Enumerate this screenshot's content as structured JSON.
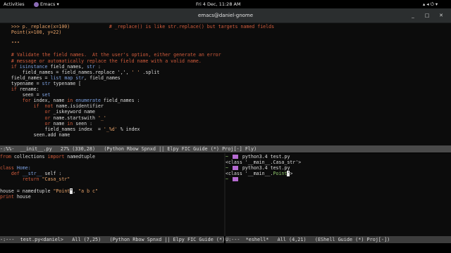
{
  "topbar": {
    "activities": "Activities",
    "app_name": "Emacs",
    "datetime": "Fri  4 Dec, 11:28 AM"
  },
  "window": {
    "title": "emacs@daniel-gnome"
  },
  "top_pane": {
    "lines": [
      [
        {
          "t": "    >>> p._replace(x=100)",
          "c": "c-str"
        },
        {
          "t": "              # _replace() is like str.replace() but targets named fields",
          "c": "c-com"
        }
      ],
      [
        {
          "t": "    Point(x=100, y=22)",
          "c": "c-str"
        }
      ],
      [
        {
          "t": "",
          "c": "c-txt"
        }
      ],
      [
        {
          "t": "    \"\"\"",
          "c": "c-str"
        }
      ],
      [
        {
          "t": "",
          "c": "c-txt"
        }
      ],
      [
        {
          "t": "    # Validate the field names.  At the user's option, either generate an error",
          "c": "c-com"
        }
      ],
      [
        {
          "t": "    # message or automatically replace the field name with a valid name.",
          "c": "c-com"
        }
      ],
      [
        {
          "t": "    if ",
          "c": "c-kw"
        },
        {
          "t": "isinstance",
          "c": "c-fn"
        },
        {
          "t": " field_names, ",
          "c": "c-txt"
        },
        {
          "t": "str",
          "c": "c-fn"
        },
        {
          "t": " :",
          "c": "c-txt"
        }
      ],
      [
        {
          "t": "        field_names = field_names.replace ','",
          "c": "c-txt"
        },
        {
          "t": ",",
          "c": "c-txt"
        },
        {
          "t": " ' '",
          "c": "c-str"
        },
        {
          "t": " .split",
          "c": "c-txt"
        }
      ],
      [
        {
          "t": "    field_names = ",
          "c": "c-txt"
        },
        {
          "t": "list",
          "c": "c-fn"
        },
        {
          "t": " ",
          "c": "c-txt"
        },
        {
          "t": "map",
          "c": "c-fn"
        },
        {
          "t": " ",
          "c": "c-txt"
        },
        {
          "t": "str",
          "c": "c-fn"
        },
        {
          "t": ", field_names",
          "c": "c-txt"
        }
      ],
      [
        {
          "t": "    typename = ",
          "c": "c-txt"
        },
        {
          "t": "str",
          "c": "c-fn"
        },
        {
          "t": " typename ",
          "c": "c-txt"
        },
        {
          "t": "[",
          "c": "c-txt"
        }
      ],
      [
        {
          "t": "    if ",
          "c": "c-kw"
        },
        {
          "t": "rename:",
          "c": "c-txt"
        }
      ],
      [
        {
          "t": "        seen = ",
          "c": "c-txt"
        },
        {
          "t": "set",
          "c": "c-fn"
        }
      ],
      [
        {
          "t": "        for ",
          "c": "c-kw"
        },
        {
          "t": "index, name ",
          "c": "c-txt"
        },
        {
          "t": "in ",
          "c": "c-kw"
        },
        {
          "t": "enumerate",
          "c": "c-fn"
        },
        {
          "t": " field_names :",
          "c": "c-txt"
        }
      ],
      [
        {
          "t": "            if ",
          "c": "c-kw"
        },
        {
          "t": " not ",
          "c": "c-kw"
        },
        {
          "t": "name.isidentifier",
          "c": "c-txt"
        }
      ],
      [
        {
          "t": "                or ",
          "c": "c-kw"
        },
        {
          "t": "_iskeyword name",
          "c": "c-txt"
        }
      ],
      [
        {
          "t": "                or ",
          "c": "c-kw"
        },
        {
          "t": "name.startswith ",
          "c": "c-txt"
        },
        {
          "t": "'_'",
          "c": "c-str"
        }
      ],
      [
        {
          "t": "                or ",
          "c": "c-kw"
        },
        {
          "t": "name ",
          "c": "c-txt"
        },
        {
          "t": "in ",
          "c": "c-kw"
        },
        {
          "t": "seen :",
          "c": "c-txt"
        }
      ],
      [
        {
          "t": "                field_names index  = ",
          "c": "c-txt"
        },
        {
          "t": "'_%d'",
          "c": "c-str"
        },
        {
          "t": " % index",
          "c": "c-txt"
        }
      ],
      [
        {
          "t": "            seen.add name",
          "c": "c-txt"
        }
      ]
    ]
  },
  "modeline_top": "-:%%-  __init__.py   27% (330,28)   (Python Rbow Spnxd || Elpy FIC Guide (*) Proj[-] Fly)",
  "left_pane": {
    "lines": [
      [
        {
          "t": "from ",
          "c": "c-kw"
        },
        {
          "t": "collections ",
          "c": "c-txt"
        },
        {
          "t": "import ",
          "c": "c-kw"
        },
        {
          "t": "namedtuple",
          "c": "c-txt"
        }
      ],
      [
        {
          "t": "",
          "c": "c-txt"
        }
      ],
      [
        {
          "t": "class ",
          "c": "c-kw"
        },
        {
          "t": "Home:",
          "c": "c-cls"
        }
      ],
      [
        {
          "t": "    def ",
          "c": "c-kw"
        },
        {
          "t": "__str__",
          "c": "c-fn"
        },
        {
          "t": " self :",
          "c": "c-txt"
        }
      ],
      [
        {
          "t": "        return ",
          "c": "c-kw"
        },
        {
          "t": "\"Casa_str\"",
          "c": "c-str"
        }
      ],
      [
        {
          "t": "",
          "c": "c-txt"
        }
      ],
      [
        {
          "t": "house = namedtuple ",
          "c": "c-txt"
        },
        {
          "t": "\"Point",
          "c": "c-str"
        },
        {
          "t": "\"",
          "c": "cursor"
        },
        {
          "t": ", ",
          "c": "c-txt"
        },
        {
          "t": "\"a b c\"",
          "c": "c-str"
        }
      ],
      [
        {
          "t": "print ",
          "c": "c-kw"
        },
        {
          "t": "house",
          "c": "c-txt"
        }
      ]
    ]
  },
  "right_pane": {
    "lines": [
      [
        {
          "t": "~ ",
          "c": "c-grn"
        },
        {
          "t": "ICON",
          "c": "icon"
        },
        {
          "t": " python3.4 test.py",
          "c": "c-txt"
        }
      ],
      [
        {
          "t": "<class '__main__.Casa_str'>",
          "c": "c-txt"
        }
      ],
      [
        {
          "t": "~ ",
          "c": "c-grn"
        },
        {
          "t": "ICON",
          "c": "icon"
        },
        {
          "t": " python3.4 test.py",
          "c": "c-txt"
        }
      ],
      [
        {
          "t": "<class '__main__.",
          "c": "c-txt"
        },
        {
          "t": "Point",
          "c": "c-grn"
        },
        {
          "t": "'",
          "c": "cursor"
        },
        {
          "t": ">",
          "c": "c-txt"
        }
      ],
      [
        {
          "t": "~ ",
          "c": "c-grn"
        },
        {
          "t": "ICON",
          "c": "icon"
        }
      ]
    ]
  },
  "modeline_left": "-:---  test.py<daniel>   All (7,25)   (Python Rbow Spnxd || Elpy FIC Guide (*) Proj[-] Fly)",
  "modeline_right": "U:---  *eshell*   All (4,21)   (EShell Guide (*) Proj[-])"
}
